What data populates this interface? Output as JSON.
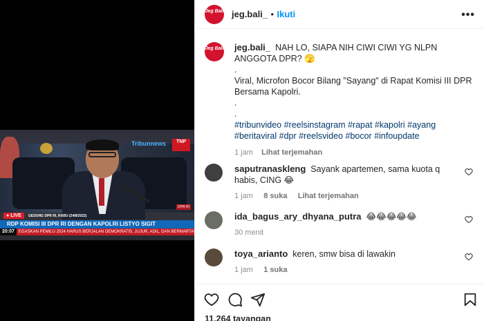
{
  "video": {
    "live_label": "LIVE",
    "location": "GEDUNG DPR RI, RABU (24/8/2022)",
    "headline": "RDP KOMISI III DPR RI DENGAN KAPOLRI LISTYO SIGIT",
    "time": "20:07",
    "ticker": "EGASKAN PEMILU 2024 HARUS BERJALAN DEMOKRATIS, JUJUR, ADIL, DAN BERMARTABAT",
    "logo_tribun": "Tribunnews",
    "logo_tnp": "TNP",
    "dpr_badge": "DPR RI"
  },
  "header": {
    "avatar_text": "Jeg Bali",
    "username": "jeg.bali_",
    "separator": "•",
    "follow_label": "Ikuti",
    "more_label": "•••"
  },
  "caption": {
    "username": "jeg.bali_",
    "line1": "NAH LO, SIAPA NIH CIWI CIWI YG NLPN ANGGOTA DPR? 🫣",
    "dot1": ".",
    "body": "Viral, Microfon Bocor Bilang \"Sayang\" di Rapat Komisi III DPR Bersama Kapolri.",
    "dot2": ".",
    "dot3": ".",
    "hashtags": "#tribunvideo #reelsinstagram #rapat #kapolri #ayang #beritaviral #dpr #reelsvideo #bocor #infoupdate",
    "time": "1 jam",
    "translate": "Lihat terjemahan"
  },
  "comments": [
    {
      "username": "saputranaskleng",
      "text": "Sayank apartemen, sama kuota q habis, CING 😂",
      "time": "1 jam",
      "likes": "8 suka",
      "translate": "Lihat terjemahan"
    },
    {
      "username": "ida_bagus_ary_dhyana_putra",
      "text": "😂😂😂😂😂",
      "time": "30 menit"
    },
    {
      "username": "toya_arianto",
      "text": "keren, smw bisa di lawakin",
      "time": "1 jam",
      "likes": "1 suka"
    }
  ],
  "footer": {
    "views": "11.264 tayangan"
  }
}
